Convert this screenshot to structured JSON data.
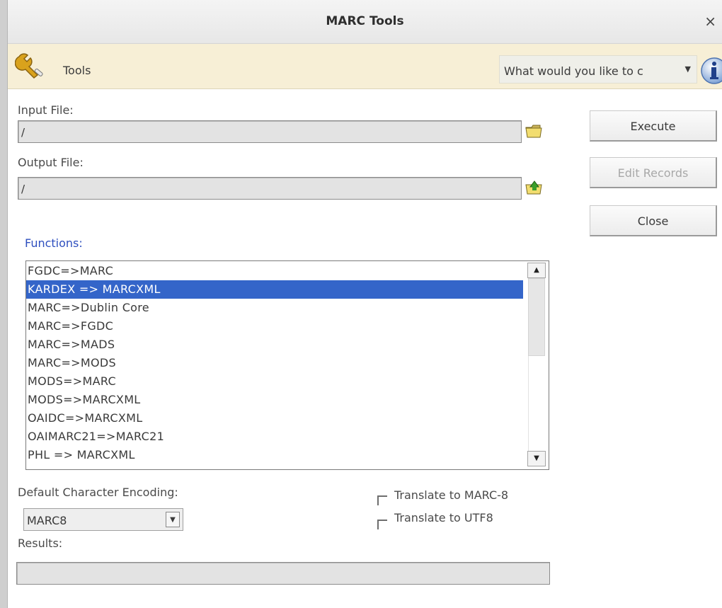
{
  "window": {
    "title": "MARC Tools",
    "close_glyph": "×"
  },
  "toolbar": {
    "tools_label": "Tools",
    "tools_icon": "wrench-icon",
    "help_placeholder": "What would you like to c",
    "help_arrow": "▼",
    "info_icon": "info-icon"
  },
  "input_file": {
    "label": "Input File:",
    "value": "/",
    "icon": "folder-open-icon"
  },
  "output_file": {
    "label": "Output File:",
    "value": "/",
    "icon": "folder-save-icon"
  },
  "buttons": {
    "execute": "Execute",
    "edit_records": "Edit Records",
    "close": "Close"
  },
  "functions": {
    "label": "Functions:",
    "items": [
      "FGDC=>MARC",
      "KARDEX => MARCXML",
      "MARC=>Dublin Core",
      "MARC=>FGDC",
      "MARC=>MADS",
      "MARC=>MODS",
      "MODS=>MARC",
      "MODS=>MARCXML",
      "OAIDC=>MARCXML",
      "OAIMARC21=>MARC21",
      "PHL => MARCXML"
    ],
    "selected_index": 1,
    "scroll_up": "▲",
    "scroll_down": "▼"
  },
  "encoding": {
    "label": "Default Character Encoding:",
    "selected": "MARC8",
    "arrow": "▼"
  },
  "options": {
    "translate_marc8": "Translate to MARC-8",
    "translate_utf8": "Translate to UTF8"
  },
  "results": {
    "label": "Results:",
    "value": ""
  },
  "colors": {
    "selection": "#3465c9",
    "functions_label": "#2e4fbf",
    "toolbar_bg": "#f7efd6"
  }
}
